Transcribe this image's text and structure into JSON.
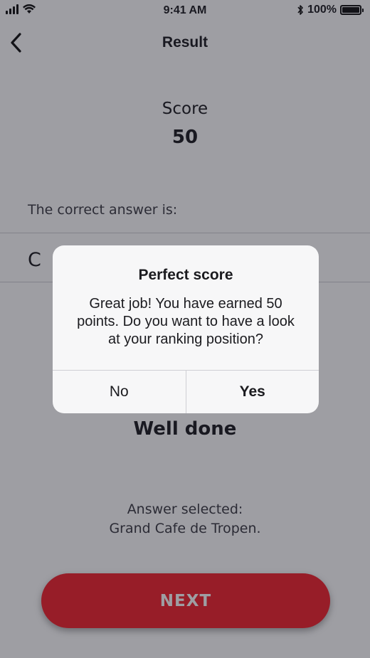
{
  "status_bar": {
    "time": "9:41 AM",
    "battery": "100%",
    "icons": [
      "signal-icon",
      "wifi-icon",
      "bluetooth-icon",
      "battery-icon"
    ]
  },
  "nav": {
    "title": "Result",
    "back_icon": "chevron-left-icon"
  },
  "score": {
    "label": "Score",
    "value": "50"
  },
  "correct_answer": {
    "label": "The correct answer is:",
    "value": "C"
  },
  "result": {
    "text": "Well done",
    "selected_label": "Answer selected:",
    "selected_value": "Grand Cafe de Tropen."
  },
  "next_button": {
    "label": "NEXT"
  },
  "dialog": {
    "title": "Perfect score",
    "message": "Great job! You have earned 50 points. Do you want to have a look at your ranking position?",
    "no_label": "No",
    "yes_label": "Yes"
  },
  "colors": {
    "accent": "#f3212b",
    "overlay": "#191923"
  }
}
